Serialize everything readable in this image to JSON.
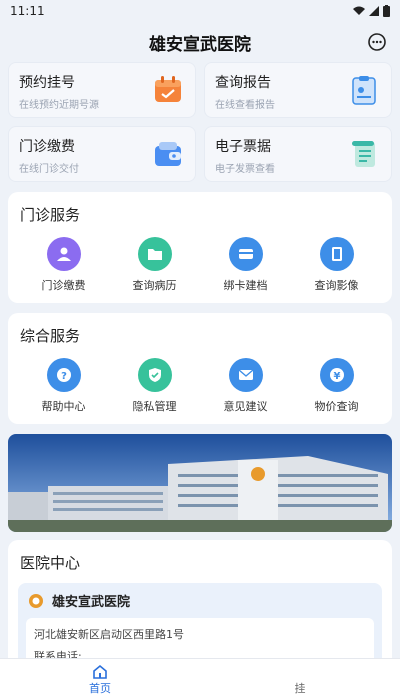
{
  "status": {
    "time": "11:11"
  },
  "header": {
    "title": "雄安宣武医院",
    "icon": "chat-bubble-icon"
  },
  "quick": [
    {
      "title": "预约挂号",
      "sub": "在线预约近期号源",
      "icon": "calendar-icon",
      "color": "#f5833a"
    },
    {
      "title": "查询报告",
      "sub": "在线查看报告",
      "icon": "report-icon",
      "color": "#3d8ee8"
    },
    {
      "title": "门诊缴费",
      "sub": "在线门诊交付",
      "icon": "wallet-icon",
      "color": "#4a8ef2"
    },
    {
      "title": "电子票据",
      "sub": "电子发票查看",
      "icon": "scroll-icon",
      "color": "#3ab8a7"
    }
  ],
  "outpatient": {
    "title": "门诊服务",
    "items": [
      {
        "label": "门诊缴费",
        "icon": "user-pay-icon",
        "color": "#8b6cf0"
      },
      {
        "label": "查询病历",
        "icon": "folder-icon",
        "color": "#37c29b"
      },
      {
        "label": "绑卡建档",
        "icon": "card-icon",
        "color": "#3d8ee8"
      },
      {
        "label": "查询影像",
        "icon": "film-icon",
        "color": "#3d8ee8"
      }
    ]
  },
  "general": {
    "title": "综合服务",
    "items": [
      {
        "label": "帮助中心",
        "icon": "help-icon",
        "color": "#3d8ee8"
      },
      {
        "label": "隐私管理",
        "icon": "shield-icon",
        "color": "#37c29b"
      },
      {
        "label": "意见建议",
        "icon": "mail-icon",
        "color": "#3d8ee8"
      },
      {
        "label": "物价查询",
        "icon": "price-icon",
        "color": "#3d8ee8"
      }
    ]
  },
  "hospital_center": {
    "title": "医院中心",
    "name": "雄安宣武医院",
    "address": "河北雄安新区启动区西里路1号",
    "phone_label": "联系电话:"
  },
  "tabs": [
    {
      "label": "首页",
      "icon": "home-icon",
      "active": true
    },
    {
      "label": "挂",
      "icon": "",
      "active": false
    }
  ]
}
